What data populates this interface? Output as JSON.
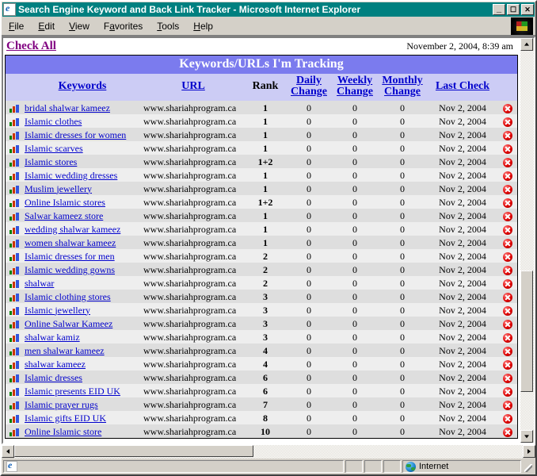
{
  "window": {
    "title": "Search Engine Keyword and Back Link Tracker - Microsoft Internet Explorer",
    "icon": "ie-document-icon",
    "buttons": {
      "minimize": "_",
      "maximize": "☐",
      "close": "✕"
    }
  },
  "menu": {
    "items": [
      {
        "label": "File",
        "accel": "F"
      },
      {
        "label": "Edit",
        "accel": "E"
      },
      {
        "label": "View",
        "accel": "V"
      },
      {
        "label": "Favorites",
        "accel": "a"
      },
      {
        "label": "Tools",
        "accel": "T"
      },
      {
        "label": "Help",
        "accel": "H"
      }
    ]
  },
  "page": {
    "check_all_label": "Check All",
    "timestamp": "November 2, 2004, 8:39 am",
    "banner_title": "Keywords/URLs I'm Tracking",
    "banner_color": "#7b7bee",
    "header_bg": "#ccccf5",
    "link_color": "#0000cc",
    "visited_link_color": "#800080"
  },
  "table": {
    "columns": [
      {
        "key": "icon",
        "label": "",
        "link": false
      },
      {
        "key": "keyword",
        "label": "Keywords",
        "link": true
      },
      {
        "key": "url",
        "label": "URL",
        "link": true
      },
      {
        "key": "rank",
        "label": "Rank",
        "link": false
      },
      {
        "key": "daily",
        "label": "Daily Change",
        "link": true
      },
      {
        "key": "weekly",
        "label": "Weekly Change",
        "link": true
      },
      {
        "key": "monthly",
        "label": "Monthly Change",
        "link": true
      },
      {
        "key": "last",
        "label": "Last Check",
        "link": true
      },
      {
        "key": "delete",
        "label": "",
        "link": false
      }
    ],
    "rows": [
      {
        "keyword": "bridal shalwar kameez",
        "url": "www.shariahprogram.ca",
        "rank": "1",
        "daily": "0",
        "weekly": "0",
        "monthly": "0",
        "last": "Nov 2, 2004"
      },
      {
        "keyword": "Islamic clothes",
        "url": "www.shariahprogram.ca",
        "rank": "1",
        "daily": "0",
        "weekly": "0",
        "monthly": "0",
        "last": "Nov 2, 2004"
      },
      {
        "keyword": "Islamic dresses for women",
        "url": "www.shariahprogram.ca",
        "rank": "1",
        "daily": "0",
        "weekly": "0",
        "monthly": "0",
        "last": "Nov 2, 2004"
      },
      {
        "keyword": "Islamic scarves",
        "url": "www.shariahprogram.ca",
        "rank": "1",
        "daily": "0",
        "weekly": "0",
        "monthly": "0",
        "last": "Nov 2, 2004"
      },
      {
        "keyword": "Islamic stores",
        "url": "www.shariahprogram.ca",
        "rank": "1+2",
        "daily": "0",
        "weekly": "0",
        "monthly": "0",
        "last": "Nov 2, 2004"
      },
      {
        "keyword": "Islamic wedding dresses",
        "url": "www.shariahprogram.ca",
        "rank": "1",
        "daily": "0",
        "weekly": "0",
        "monthly": "0",
        "last": "Nov 2, 2004"
      },
      {
        "keyword": "Muslim jewellery",
        "url": "www.shariahprogram.ca",
        "rank": "1",
        "daily": "0",
        "weekly": "0",
        "monthly": "0",
        "last": "Nov 2, 2004"
      },
      {
        "keyword": "Online Islamic stores",
        "url": "www.shariahprogram.ca",
        "rank": "1+2",
        "daily": "0",
        "weekly": "0",
        "monthly": "0",
        "last": "Nov 2, 2004"
      },
      {
        "keyword": "Salwar kameez store",
        "url": "www.shariahprogram.ca",
        "rank": "1",
        "daily": "0",
        "weekly": "0",
        "monthly": "0",
        "last": "Nov 2, 2004"
      },
      {
        "keyword": "wedding shalwar kameez",
        "url": "www.shariahprogram.ca",
        "rank": "1",
        "daily": "0",
        "weekly": "0",
        "monthly": "0",
        "last": "Nov 2, 2004"
      },
      {
        "keyword": "women shalwar kameez",
        "url": "www.shariahprogram.ca",
        "rank": "1",
        "daily": "0",
        "weekly": "0",
        "monthly": "0",
        "last": "Nov 2, 2004"
      },
      {
        "keyword": "Islamic dresses for men",
        "url": "www.shariahprogram.ca",
        "rank": "2",
        "daily": "0",
        "weekly": "0",
        "monthly": "0",
        "last": "Nov 2, 2004"
      },
      {
        "keyword": "Islamic wedding gowns",
        "url": "www.shariahprogram.ca",
        "rank": "2",
        "daily": "0",
        "weekly": "0",
        "monthly": "0",
        "last": "Nov 2, 2004"
      },
      {
        "keyword": "shalwar",
        "url": "www.shariahprogram.ca",
        "rank": "2",
        "daily": "0",
        "weekly": "0",
        "monthly": "0",
        "last": "Nov 2, 2004"
      },
      {
        "keyword": "Islamic clothing stores",
        "url": "www.shariahprogram.ca",
        "rank": "3",
        "daily": "0",
        "weekly": "0",
        "monthly": "0",
        "last": "Nov 2, 2004"
      },
      {
        "keyword": "Islamic jewellery",
        "url": "www.shariahprogram.ca",
        "rank": "3",
        "daily": "0",
        "weekly": "0",
        "monthly": "0",
        "last": "Nov 2, 2004"
      },
      {
        "keyword": "Online Salwar Kameez",
        "url": "www.shariahprogram.ca",
        "rank": "3",
        "daily": "0",
        "weekly": "0",
        "monthly": "0",
        "last": "Nov 2, 2004"
      },
      {
        "keyword": "shalwar kamiz",
        "url": "www.shariahprogram.ca",
        "rank": "3",
        "daily": "0",
        "weekly": "0",
        "monthly": "0",
        "last": "Nov 2, 2004"
      },
      {
        "keyword": "men shalwar kameez",
        "url": "www.shariahprogram.ca",
        "rank": "4",
        "daily": "0",
        "weekly": "0",
        "monthly": "0",
        "last": "Nov 2, 2004"
      },
      {
        "keyword": "shalwar kameez",
        "url": "www.shariahprogram.ca",
        "rank": "4",
        "daily": "0",
        "weekly": "0",
        "monthly": "0",
        "last": "Nov 2, 2004"
      },
      {
        "keyword": "Islamic dresses",
        "url": "www.shariahprogram.ca",
        "rank": "6",
        "daily": "0",
        "weekly": "0",
        "monthly": "0",
        "last": "Nov 2, 2004"
      },
      {
        "keyword": "Islamic presents EID UK",
        "url": "www.shariahprogram.ca",
        "rank": "6",
        "daily": "0",
        "weekly": "0",
        "monthly": "0",
        "last": "Nov 2, 2004"
      },
      {
        "keyword": "Islamic prayer rugs",
        "url": "www.shariahprogram.ca",
        "rank": "7",
        "daily": "0",
        "weekly": "0",
        "monthly": "0",
        "last": "Nov 2, 2004"
      },
      {
        "keyword": "Islamic gifts EID UK",
        "url": "www.shariahprogram.ca",
        "rank": "8",
        "daily": "0",
        "weekly": "0",
        "monthly": "0",
        "last": "Nov 2, 2004"
      },
      {
        "keyword": "Online Islamic store",
        "url": "www.shariahprogram.ca",
        "rank": "10",
        "daily": "0",
        "weekly": "0",
        "monthly": "0",
        "last": "Nov 2, 2004"
      }
    ]
  },
  "statusbar": {
    "message": "",
    "zone_label": "Internet",
    "zone_icon": "globe-icon"
  }
}
